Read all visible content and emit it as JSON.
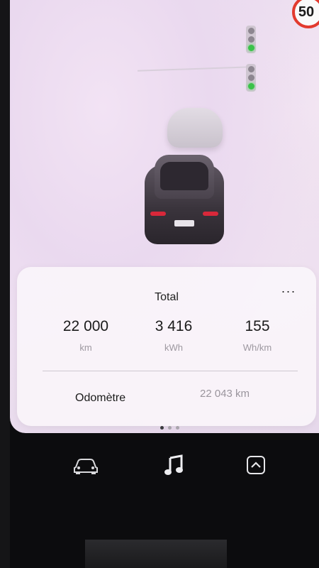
{
  "map": {
    "speed_limit": "50"
  },
  "trip_card": {
    "title": "Total",
    "more_label": "···",
    "stats": [
      {
        "value": "22 000",
        "unit": "km"
      },
      {
        "value": "3 416",
        "unit": "kWh"
      },
      {
        "value": "155",
        "unit": "Wh/km"
      }
    ],
    "odometer_label": "Odomètre",
    "odometer_value": "22 043 km"
  },
  "pager": {
    "count": 3,
    "active": 1
  },
  "dock": {
    "icons": [
      "car-icon",
      "music-note-icon",
      "chevron-up-icon"
    ]
  },
  "colors": {
    "speed_sign_ring": "#e23a2e",
    "traffic_green": "#3bc24a",
    "brake_light": "#d8283a"
  }
}
